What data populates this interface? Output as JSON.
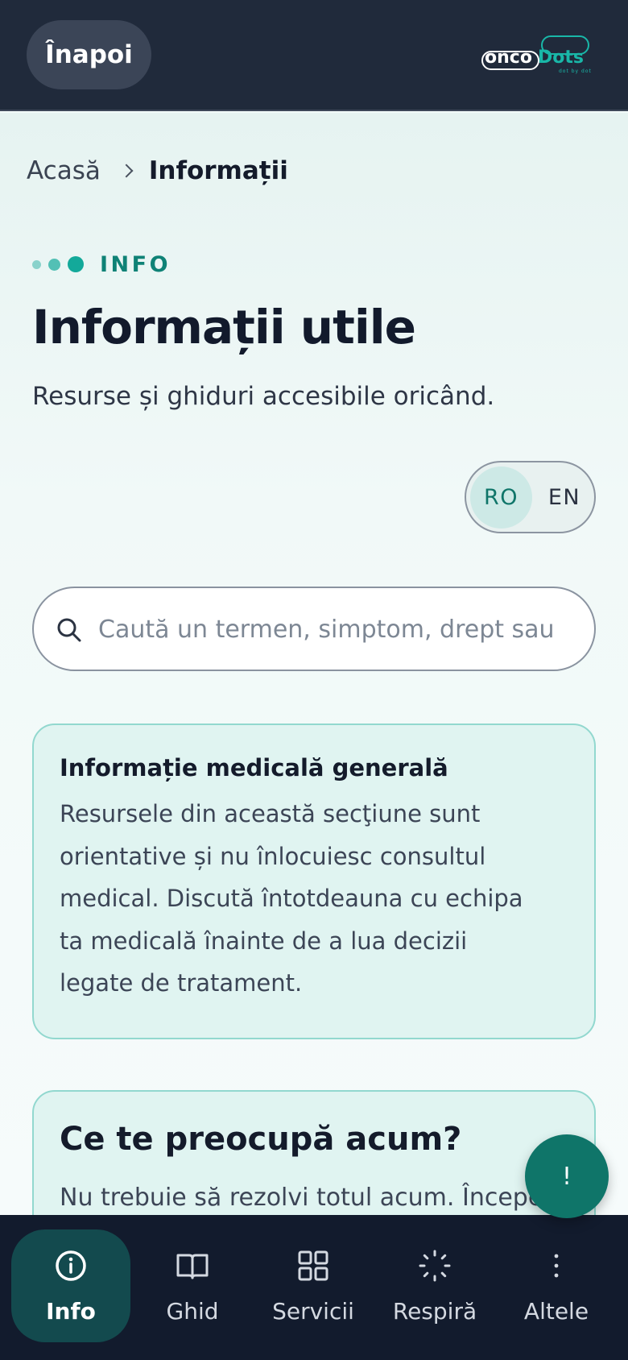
{
  "header": {
    "back_label": "Înapoi",
    "logo_text_onco": "onco",
    "logo_text_dots": "Dots",
    "logo_tagline": "dot by dot"
  },
  "breadcrumb": {
    "home": "Acasă",
    "current": "Informații"
  },
  "hero": {
    "eyebrow": "INFO",
    "title": "Informații utile",
    "subtitle": "Resurse și ghiduri accesibile oricând."
  },
  "language": {
    "selected": "RO",
    "options": [
      "RO",
      "EN"
    ]
  },
  "search": {
    "placeholder": "Caută un termen, simptom, drept sau",
    "value": ""
  },
  "notice": {
    "title": "Informație medicală generală",
    "body_lines": [
      "Resursele din această secţiune sunt",
      "orientative și nu înlocuiesc consultul",
      "medical. Discută întotdeauna cu echipa",
      "ta medicală înainte de a lua decizii",
      "legate de tratament."
    ]
  },
  "concern": {
    "title": "Ce te preocupă acum?",
    "body": "Nu trebuie să rezolvi totul acum. Începe"
  },
  "fab": {
    "label": "!"
  },
  "bottom_nav": {
    "items": [
      {
        "label": "Info",
        "icon": "info-icon",
        "active": true
      },
      {
        "label": "Ghid",
        "icon": "book-icon",
        "active": false
      },
      {
        "label": "Servicii",
        "icon": "grid-icon",
        "active": false
      },
      {
        "label": "Respiră",
        "icon": "breathe-loader-icon",
        "active": false
      },
      {
        "label": "Altele",
        "icon": "more-vertical-icon",
        "active": false
      }
    ]
  },
  "colors": {
    "header_bg": "#202a3b",
    "accent": "#13a99a",
    "accent_dark": "#0f7569",
    "nav_bg": "#121b2d",
    "nav_active_bg": "#134a4e",
    "notice_bg": "#e0f4f1"
  }
}
